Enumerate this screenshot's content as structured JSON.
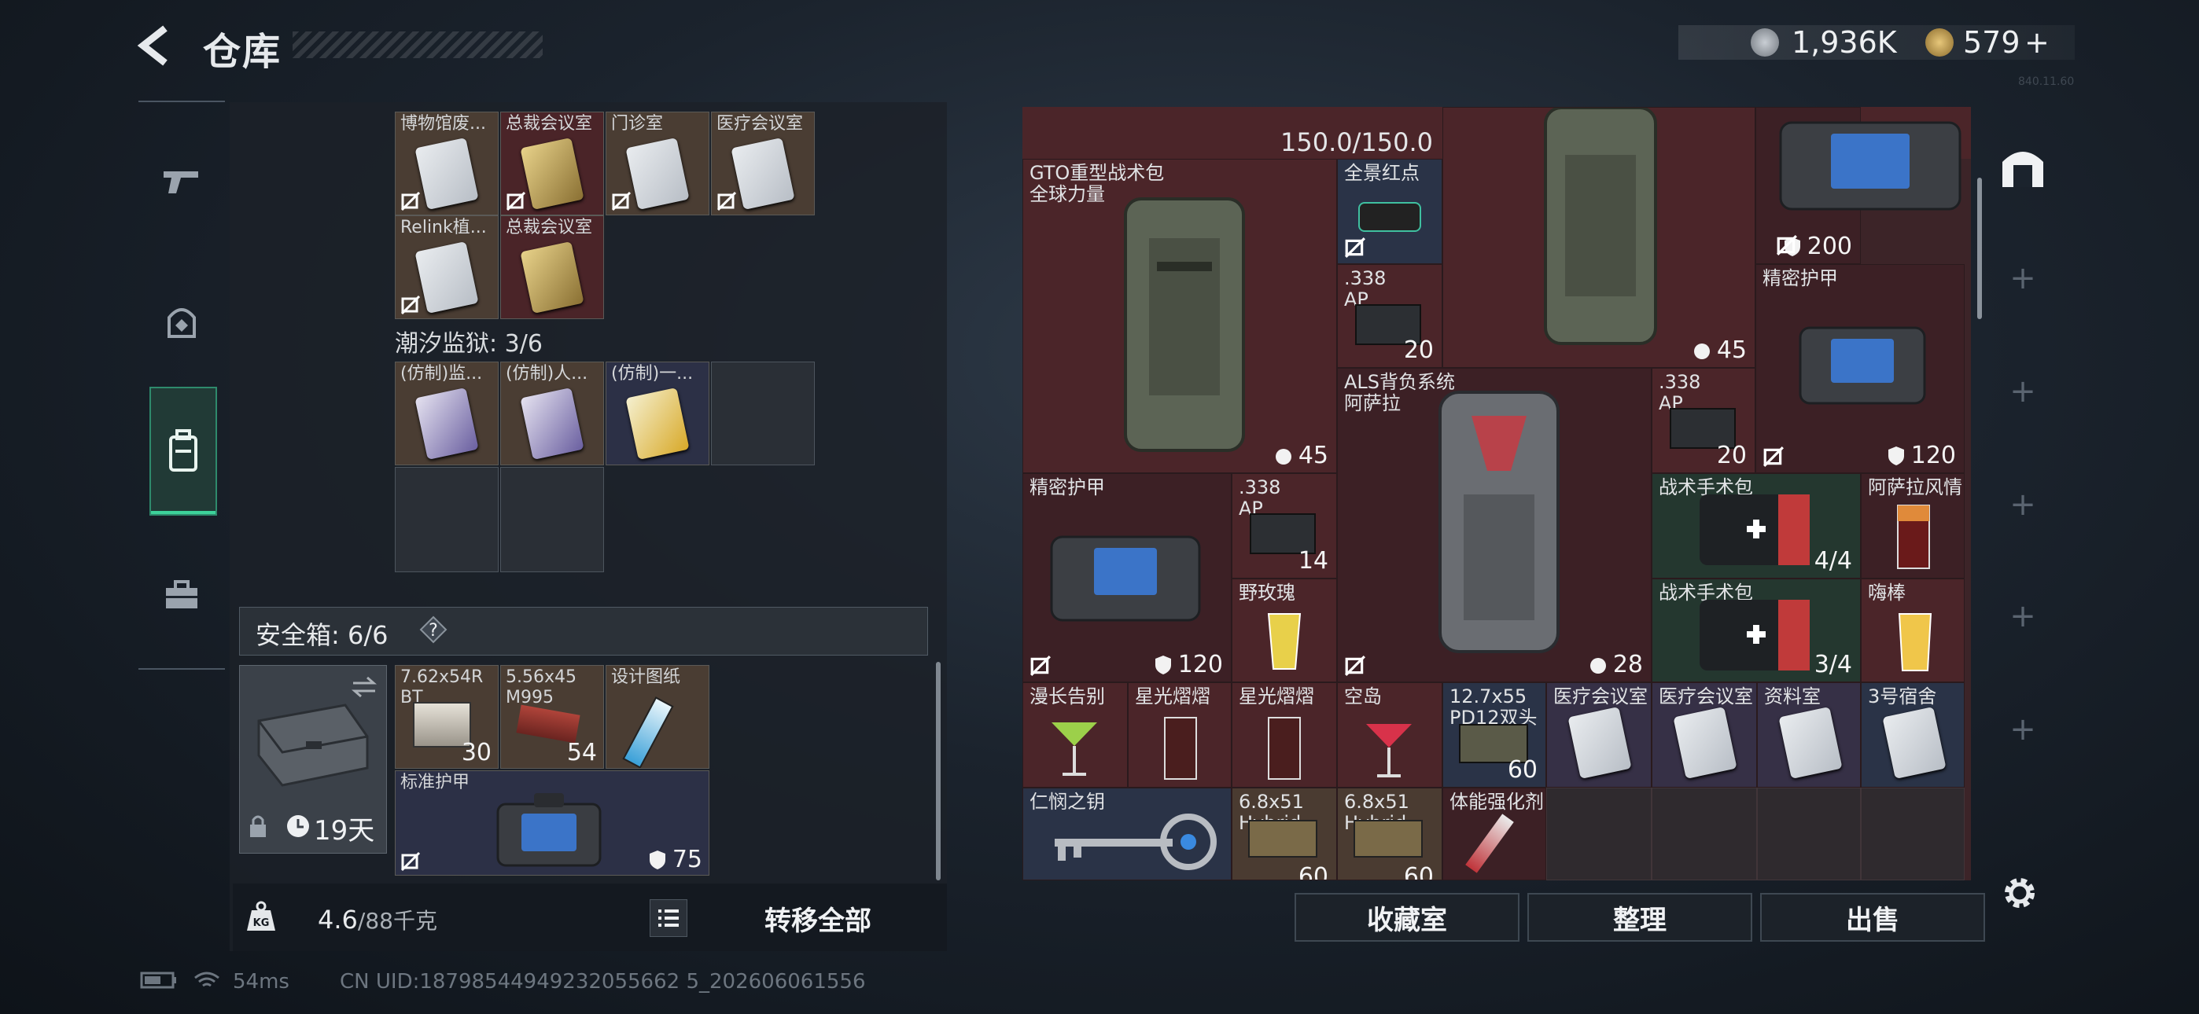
{
  "header": {
    "title": "仓库",
    "currency_a": "1,936K",
    "currency_b": "579",
    "currency_b_plus": "+",
    "version_tag": "840.11.60"
  },
  "left_panel": {
    "row1": [
      {
        "label": "博物馆废..."
      },
      {
        "label": "总裁会议室"
      },
      {
        "label": "门诊室"
      },
      {
        "label": "医疗会议室"
      }
    ],
    "row2": [
      {
        "label": "Relink植..."
      },
      {
        "label": "总裁会议室"
      }
    ],
    "prison_label": "潮汐监狱: 3/6",
    "prison_cards": [
      {
        "label": "(仿制)监..."
      },
      {
        "label": "(仿制)人..."
      },
      {
        "label": "(仿制)一..."
      }
    ],
    "safe_box": {
      "label": "安全箱:  6/6",
      "help": "?",
      "days": "19天"
    },
    "safe_items": [
      {
        "label": "7.62x54R\nBT",
        "qty": "30"
      },
      {
        "label": "5.56x45\nM995",
        "qty": "54"
      },
      {
        "label": "设计图纸",
        "qty": ""
      },
      {
        "label": "标准护甲",
        "durability": "75"
      }
    ],
    "weight": "4.6",
    "weight_cap": "/88千克",
    "transfer_all": "转移全部"
  },
  "right_panel": {
    "capacity": "150.0/150.0",
    "items": [
      {
        "key": "top_bag",
        "label": "",
        "durability": "200"
      },
      {
        "key": "gto",
        "label": "GTO重型战术包\n全球力量",
        "weight": "45"
      },
      {
        "key": "scope",
        "label": "全景红点"
      },
      {
        "key": "ap1",
        "label": ".338\nAP",
        "qty": "20"
      },
      {
        "key": "vest_top",
        "label": "",
        "weight": "45"
      },
      {
        "key": "armor1",
        "label": "精密护甲",
        "durability": "120"
      },
      {
        "key": "als",
        "label": "ALS背负系统\n阿萨拉",
        "weight": "28"
      },
      {
        "key": "ap2",
        "label": ".338\nAP",
        "qty": "20"
      },
      {
        "key": "armor2",
        "label": "精密护甲",
        "durability": "120"
      },
      {
        "key": "ap3",
        "label": ".338\nAP",
        "qty": "14"
      },
      {
        "key": "rose",
        "label": "野玫瑰"
      },
      {
        "key": "kit1",
        "label": "战术手术包",
        "qty": "4/4"
      },
      {
        "key": "asala_drink",
        "label": "阿萨拉风情"
      },
      {
        "key": "kit2",
        "label": "战术手术包",
        "qty": "3/4"
      },
      {
        "key": "hibang",
        "label": "嗨棒"
      },
      {
        "key": "farewell",
        "label": "漫长告别"
      },
      {
        "key": "star1",
        "label": "星光熠熠"
      },
      {
        "key": "star2",
        "label": "星光熠熠"
      },
      {
        "key": "sky",
        "label": "空岛"
      },
      {
        "key": "pd12",
        "label": "12.7x55\nPD12双头",
        "qty": "60"
      },
      {
        "key": "med_room1",
        "label": "医疗会议室"
      },
      {
        "key": "med_room2",
        "label": "医疗会议室"
      },
      {
        "key": "archive",
        "label": "资料室"
      },
      {
        "key": "dorm3",
        "label": "3号宿舍"
      },
      {
        "key": "key_ren",
        "label": "仁悯之钥"
      },
      {
        "key": "hybrid1",
        "label": "6.8x51\nHybrid",
        "qty": "60"
      },
      {
        "key": "hybrid2",
        "label": "6.8x51\nHybrid",
        "qty": "60"
      },
      {
        "key": "stim",
        "label": "体能强化剂"
      }
    ]
  },
  "buttons": {
    "collection": "收藏室",
    "sort": "整理",
    "sell": "出售"
  },
  "status": {
    "ping": "54ms",
    "uid": "CN UID:18798544949232055662 5_202606061556"
  },
  "colors": {
    "accent_green": "#3dd29a",
    "panel_red": "#4b2529",
    "panel_dark": "#1c2229"
  }
}
